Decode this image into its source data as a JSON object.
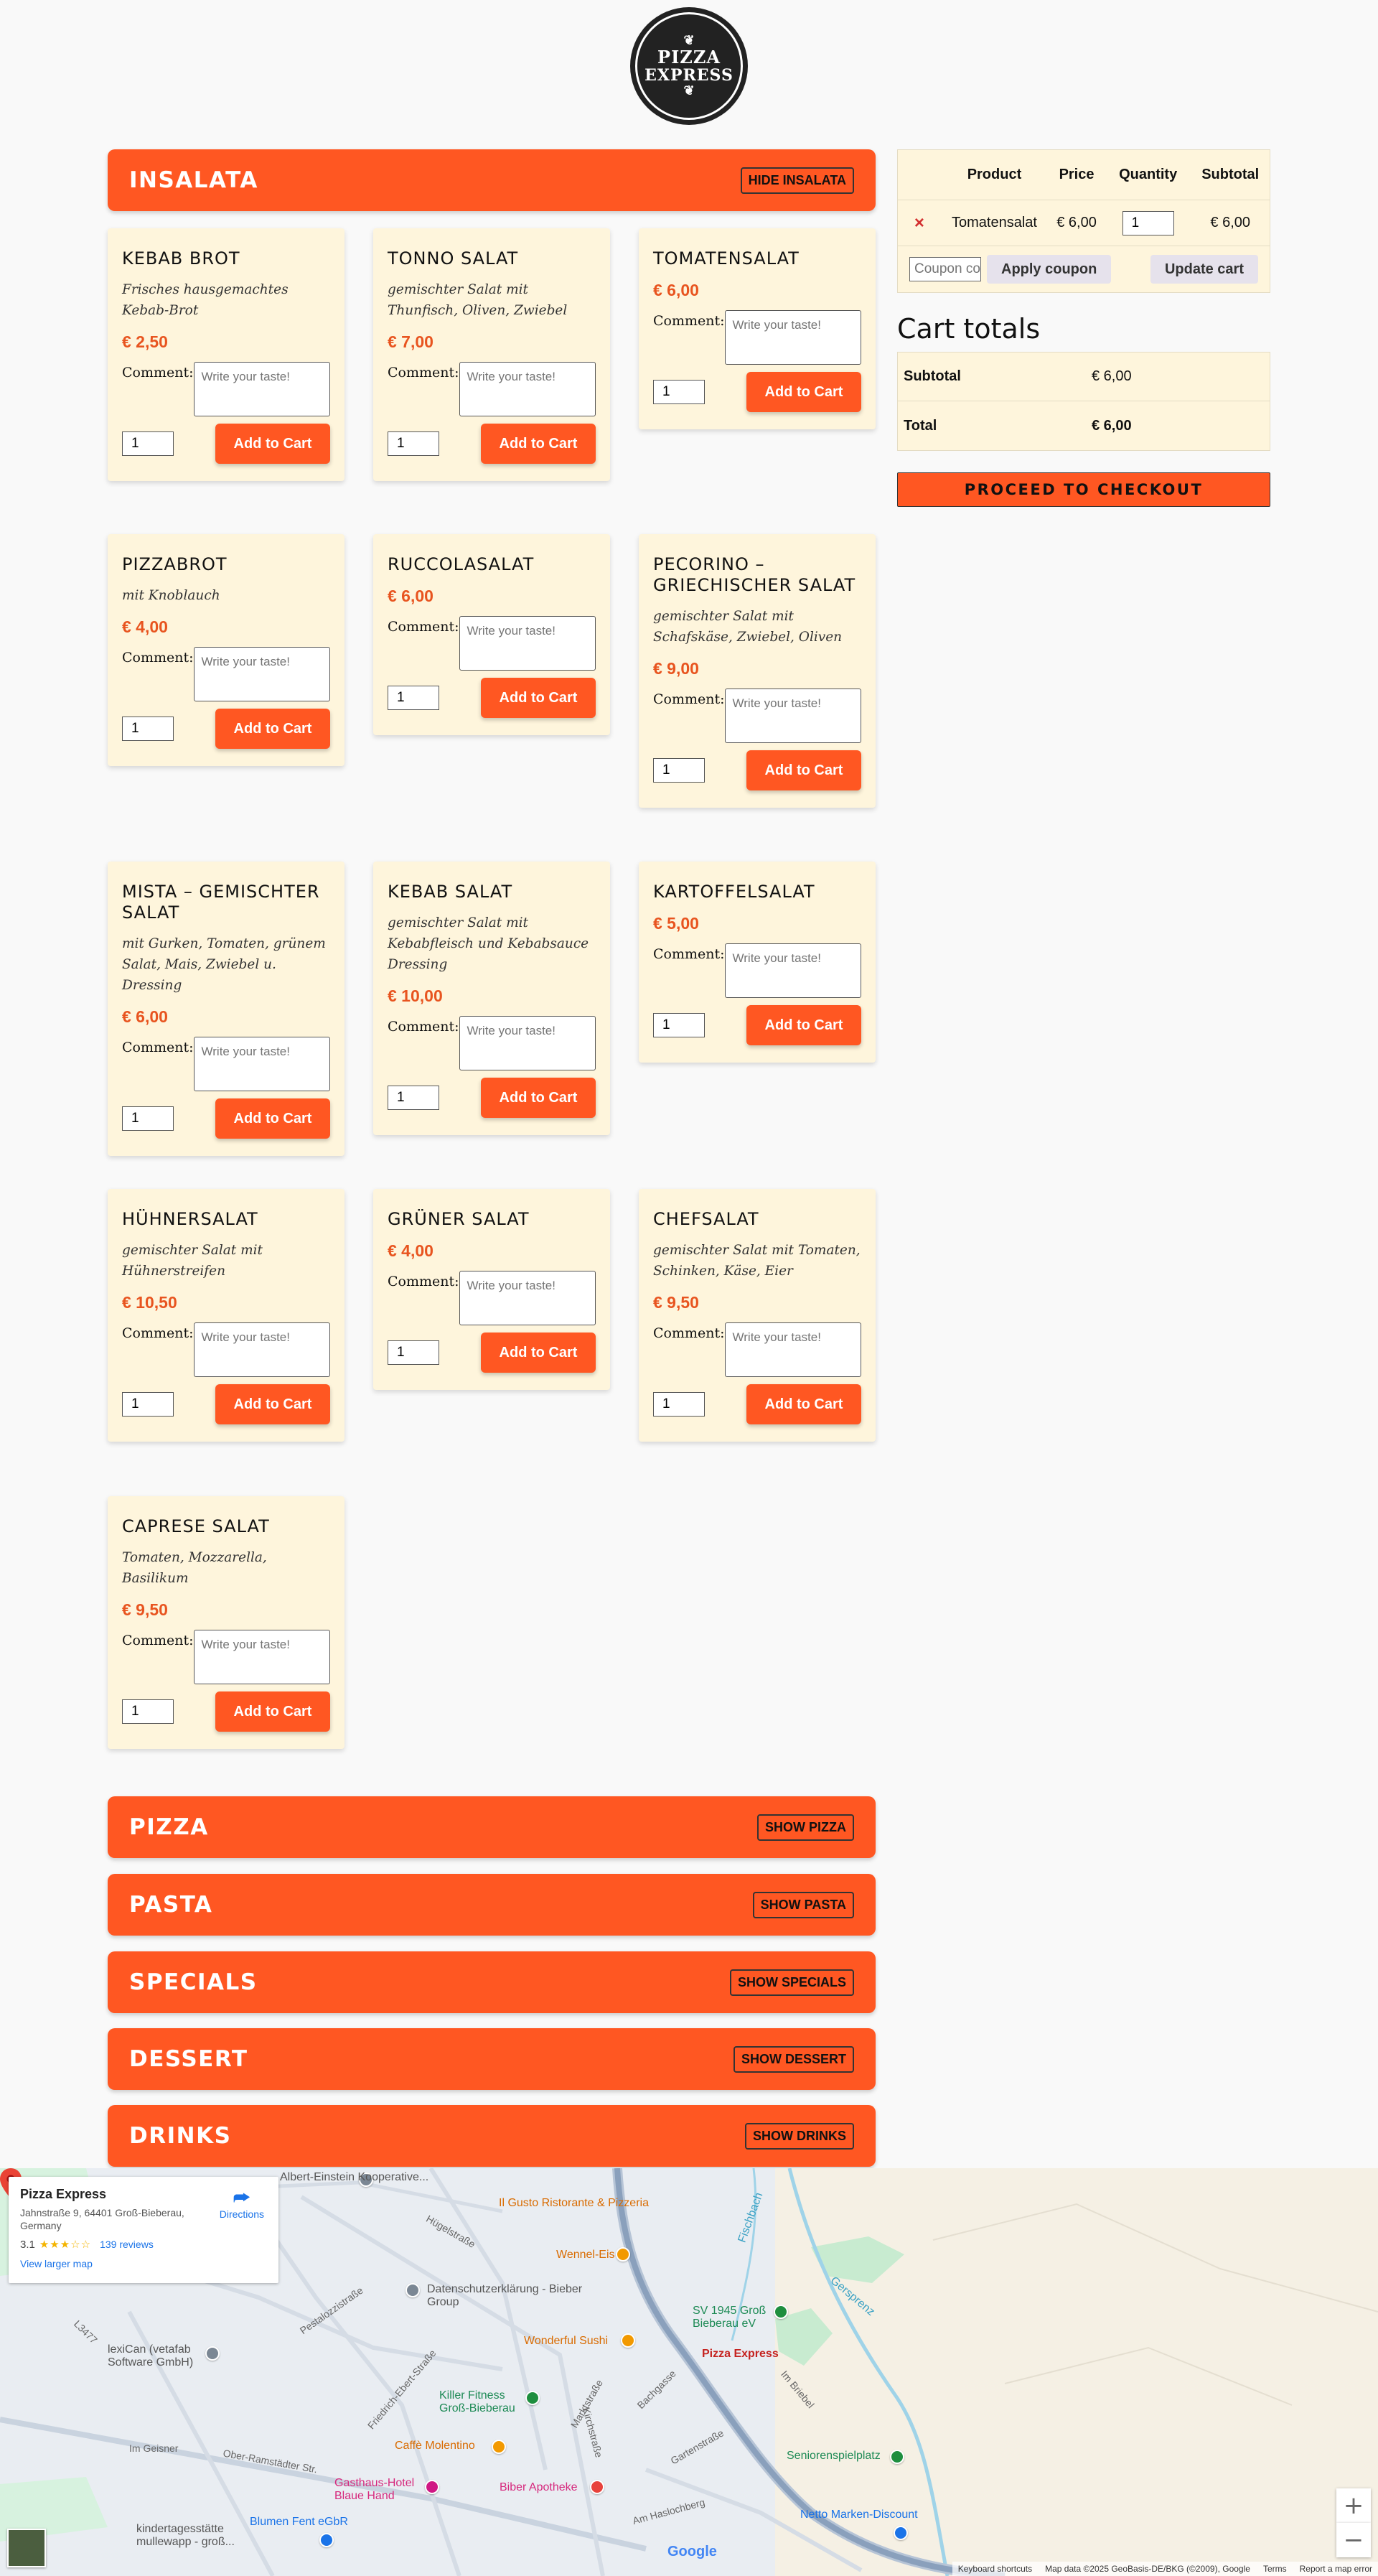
{
  "logo": {
    "line1": "PIZZA",
    "line2": "EXPRESS"
  },
  "categories": {
    "insalata": {
      "title": "INSALATA",
      "toggle": "HIDE INSALATA"
    },
    "pizza": {
      "title": "PIZZA",
      "toggle": "SHOW PIZZA"
    },
    "pasta": {
      "title": "PASTA",
      "toggle": "SHOW PASTA"
    },
    "specials": {
      "title": "SPECIALS",
      "toggle": "SHOW SPECIALS"
    },
    "dessert": {
      "title": "DESSERT",
      "toggle": "SHOW DESSERT"
    },
    "drinks": {
      "title": "DRINKS",
      "toggle": "SHOW DRINKS"
    }
  },
  "labels": {
    "comment": "Comment:",
    "comment_placeholder": "Write your taste!",
    "add_to_cart": "Add to Cart",
    "qty_default": "1"
  },
  "products": [
    {
      "name": "KEBAB BROT",
      "desc": "Frisches hausgemachtes Kebab-Brot",
      "price": "€ 2,50"
    },
    {
      "name": "TONNO SALAT",
      "desc": "gemischter Salat mit Thunfisch, Oliven, Zwiebel",
      "price": "€ 7,00"
    },
    {
      "name": "TOMATENSALAT",
      "desc": "",
      "price": "€ 6,00"
    },
    {
      "name": "PIZZABROT",
      "desc": "mit Knoblauch",
      "price": "€ 4,00"
    },
    {
      "name": "RUCCOLASALAT",
      "desc": "",
      "price": "€ 6,00"
    },
    {
      "name": "PECORINO – GRIECHISCHER SALAT",
      "desc": "gemischter Salat mit Schafskäse, Zwiebel, Oliven",
      "price": "€ 9,00"
    },
    {
      "name": "MISTA – GEMISCHTER SALAT",
      "desc": "mit Gurken, Tomaten, grünem Salat, Mais, Zwiebel u. Dressing",
      "price": "€ 6,00"
    },
    {
      "name": "KEBAB SALAT",
      "desc": "gemischter Salat mit Kebabfleisch und Kebabsauce Dressing",
      "price": "€ 10,00"
    },
    {
      "name": "KARTOFFELSALAT",
      "desc": "",
      "price": "€ 5,00"
    },
    {
      "name": "HÜHNERSALAT",
      "desc": "gemischter Salat mit Hühnerstreifen",
      "price": "€ 10,50"
    },
    {
      "name": "GRÜNER SALAT",
      "desc": "",
      "price": "€ 4,00"
    },
    {
      "name": "CHEFSALAT",
      "desc": "gemischter Salat mit Tomaten, Schinken, Käse, Eier",
      "price": "€ 9,50"
    },
    {
      "name": "CAPRESE SALAT",
      "desc": "Tomaten, Mozzarella, Basilikum",
      "price": "€ 9,50"
    }
  ],
  "cart": {
    "headers": {
      "product": "Product",
      "price": "Price",
      "quantity": "Quantity",
      "subtotal": "Subtotal"
    },
    "items": [
      {
        "remove": "×",
        "product": "Tomatensalat",
        "price": "€ 6,00",
        "qty": "1",
        "subtotal": "€ 6,00"
      }
    ],
    "coupon_placeholder": "Coupon code",
    "apply_coupon": "Apply coupon",
    "update_cart": "Update cart",
    "totals_title": "Cart totals",
    "subtotal_label": "Subtotal",
    "subtotal_value": "€ 6,00",
    "total_label": "Total",
    "total_value": "€ 6,00",
    "checkout": "PROCEED TO CHECKOUT"
  },
  "map": {
    "place_name": "Pizza Express",
    "address": "Jahnstraße 9, 64401 Groß-Bieberau, Germany",
    "rating": "3.1",
    "stars": "★★★☆☆",
    "reviews": "139 reviews",
    "view_larger": "View larger map",
    "directions": "Directions",
    "zoom_in": "+",
    "zoom_out": "−",
    "google": "Google",
    "footer": {
      "shortcuts": "Keyboard shortcuts",
      "data": "Map data ©2025 GeoBasis-DE/BKG (©2009), Google",
      "terms": "Terms",
      "report": "Report a map error"
    },
    "pois": {
      "albert": "Albert-Einstein Kooperative...",
      "ilgusto": "Il Gusto Ristorante & Pizzeria",
      "wennel": "Wennel-Eis",
      "datenschutz": "Datenschutzerklärung - Bieber Group",
      "wonderful": "Wonderful Sushi",
      "sv1945": "SV 1945 Groß Bieberau eV",
      "pizzaexpress": "Pizza Express",
      "lexican": "lexiCan (vetafab Software GmbH)",
      "killer": "Killer Fitness Groß-Bieberau",
      "caffe": "Caffè Molentino",
      "gasthaus": "Gasthaus-Hotel Blaue Hand",
      "biber": "Biber Apotheke",
      "senioren": "Seniorenspielplatz",
      "netto": "Netto Marken-Discount",
      "blumen": "Blumen Fent eGbR",
      "kinder": "kindertagesstätte mullewapp - groß...",
      "hugel": "Hügelstraße",
      "pestalozzi": "Pestalozzistraße",
      "friedrich": "Friedrich-Ebert-Straße",
      "markt": "Marktstraße",
      "gersprenz": "Gersprenz",
      "fischbach": "Fischbach",
      "imgeisner": "Im Geisner",
      "oberram": "Ober-Ramstädter Str.",
      "garten": "Gartenstraße",
      "amhasl": "Am Haslochberg",
      "imbriebel": "Im Briebel",
      "l3477": "L3477",
      "bachgasse": "Bachgasse",
      "kirchstr": "Kirchstraße"
    }
  },
  "colors": {
    "accent": "#ff5722",
    "card_bg": "#fef5dc",
    "price": "#e8541f"
  }
}
